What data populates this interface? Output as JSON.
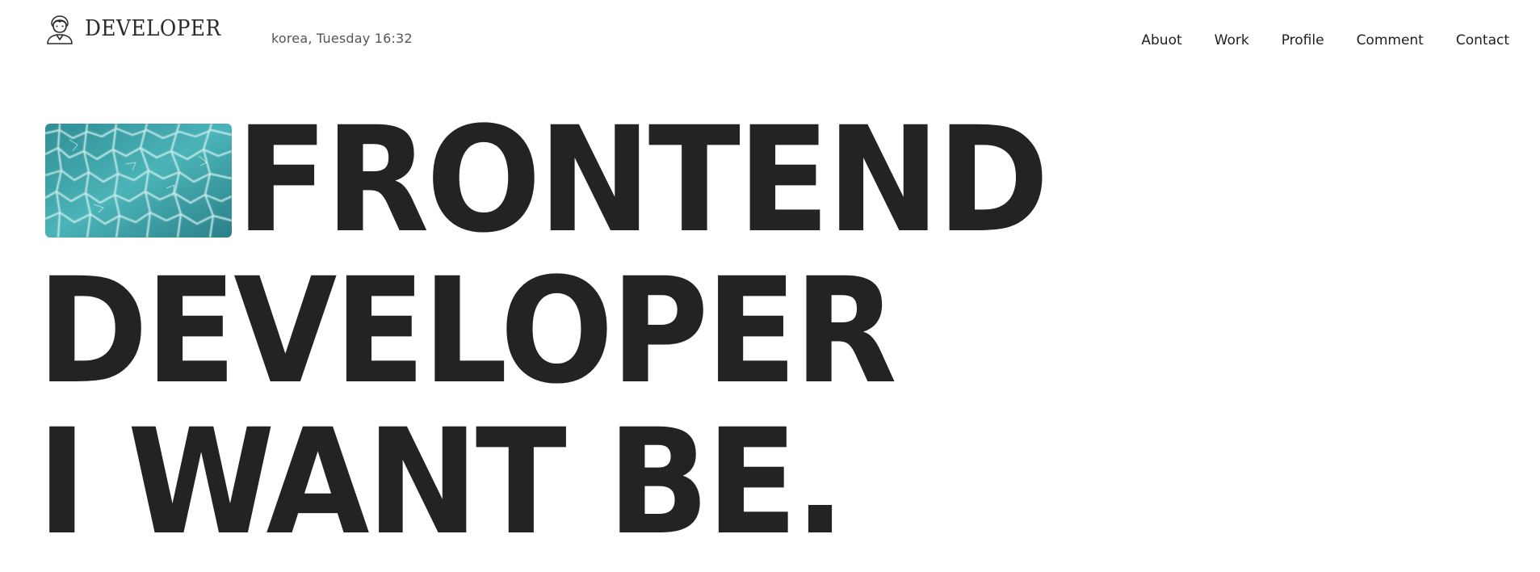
{
  "header": {
    "logo_text": "DEVELOPER",
    "logo_icon": "developer-avatar-icon",
    "datetime": "korea, Tuesday 16:32"
  },
  "nav": {
    "items": [
      {
        "label": "Abuot"
      },
      {
        "label": "Work"
      },
      {
        "label": "Profile"
      },
      {
        "label": "Comment"
      },
      {
        "label": "Contact"
      }
    ]
  },
  "hero": {
    "line1": "FRONTEND",
    "line2": "DEVELOPER",
    "line3": "I WANT BE.",
    "image": "water-ripple-image"
  },
  "colors": {
    "text": "#232323",
    "background": "#ffffff",
    "water": "#3a9ea5"
  }
}
